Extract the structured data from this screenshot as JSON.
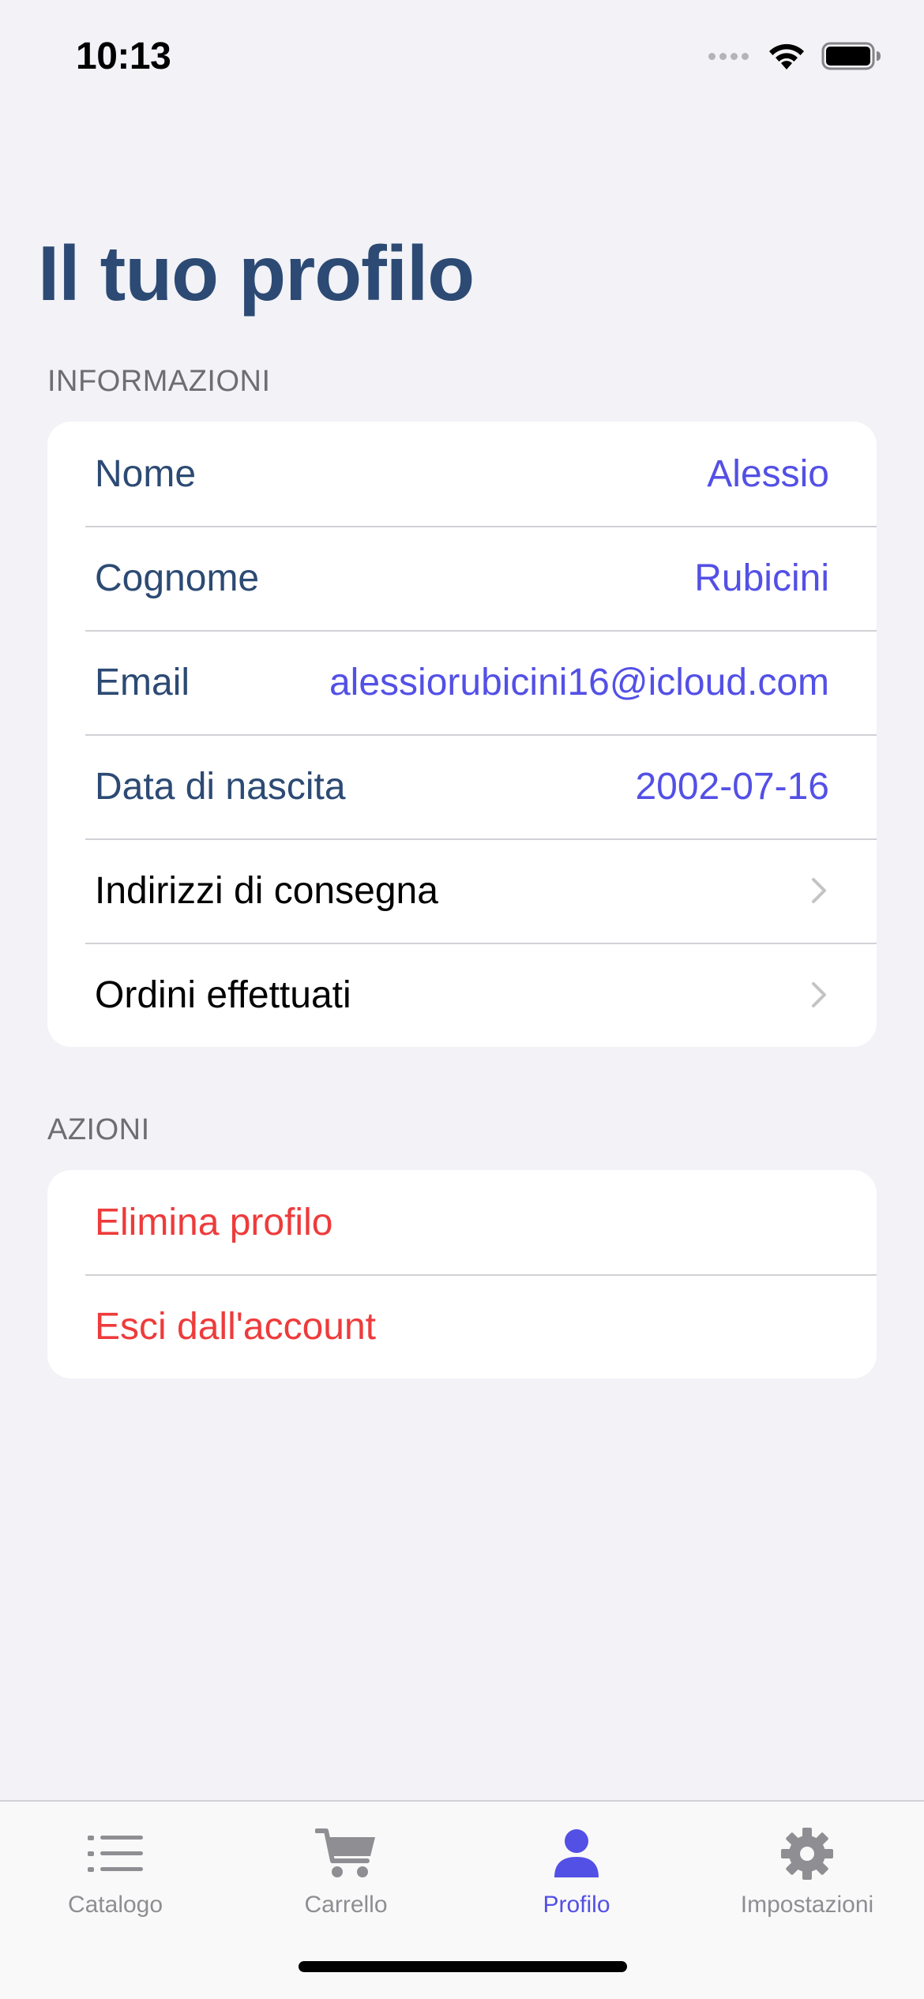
{
  "status_bar": {
    "time": "10:13"
  },
  "title": "Il tuo profilo",
  "sections": {
    "info": {
      "header": "INFORMAZIONI",
      "nome_label": "Nome",
      "nome_value": "Alessio",
      "cognome_label": "Cognome",
      "cognome_value": "Rubicini",
      "email_label": "Email",
      "email_value": "alessiorubicini16@icloud.com",
      "nascita_label": "Data di nascita",
      "nascita_value": "2002-07-16",
      "indirizzi_label": "Indirizzi di consegna",
      "ordini_label": "Ordini effettuati"
    },
    "actions": {
      "header": "AZIONI",
      "delete_label": "Elimina profilo",
      "logout_label": "Esci dall'account"
    }
  },
  "tabs": [
    {
      "label": "Catalogo",
      "icon": "list-icon",
      "active": false
    },
    {
      "label": "Carrello",
      "icon": "cart-icon",
      "active": false
    },
    {
      "label": "Profilo",
      "icon": "person-icon",
      "active": true
    },
    {
      "label": "Impostazioni",
      "icon": "gear-icon",
      "active": false
    }
  ],
  "colors": {
    "accent": "#5350e6",
    "title": "#2c4a73",
    "danger": "#ee3b3b",
    "background": "#f2f2f7"
  }
}
